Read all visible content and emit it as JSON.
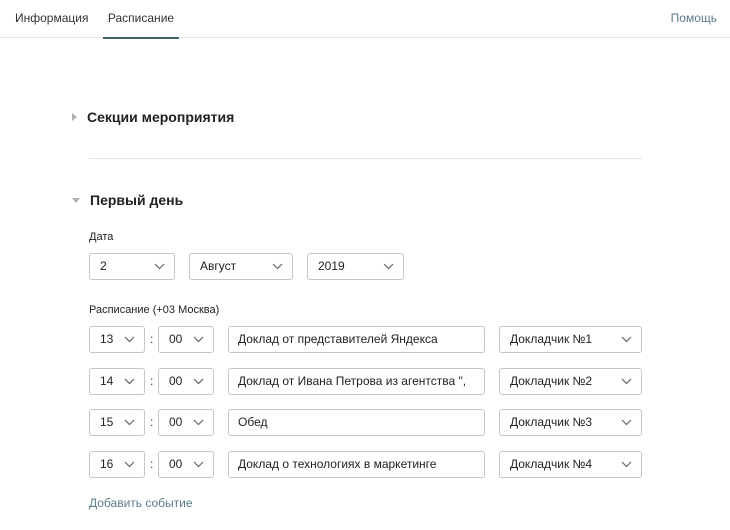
{
  "tabs": {
    "info_label": "Информация",
    "schedule_label": "Расписание",
    "help_label": "Помощь"
  },
  "sections": {
    "event_sections_title": "Секции мероприятия",
    "first_day_title": "Первый день"
  },
  "date": {
    "label": "Дата",
    "day": "2",
    "month": "Август",
    "year": "2019"
  },
  "schedule": {
    "label": "Расписание (+03 Москва)",
    "colon": ":",
    "rows": [
      {
        "hour": "13",
        "minute": "00",
        "title": "Доклад от представителей Яндекса",
        "speaker": "Докладчик №1"
      },
      {
        "hour": "14",
        "minute": "00",
        "title": "Доклад от Ивана Петрова из агентства \",",
        "speaker": "Докладчик №2"
      },
      {
        "hour": "15",
        "minute": "00",
        "title": "Обед",
        "speaker": "Докладчик №3"
      },
      {
        "hour": "16",
        "minute": "00",
        "title": "Доклад о технологиях в маркетинге",
        "speaker": "Докладчик №4"
      }
    ]
  },
  "actions": {
    "add_event_label": "Добавить событие"
  },
  "colors": {
    "accent": "#3f5f6f",
    "link": "#5a7a8c",
    "border": "#c6c6c6"
  }
}
